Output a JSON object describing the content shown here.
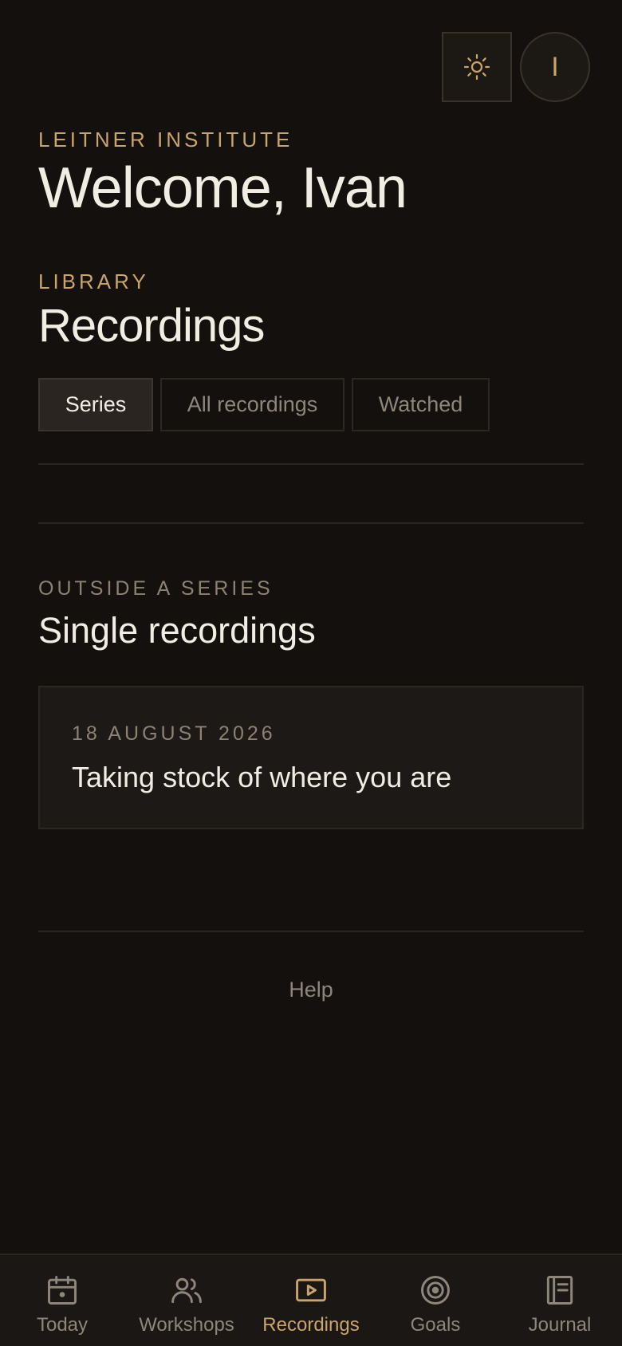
{
  "header": {
    "avatar_initial": "I",
    "theme_icon": "sun-icon"
  },
  "welcome": {
    "org": "LEITNER INSTITUTE",
    "greeting": "Welcome, Ivan"
  },
  "library": {
    "eyebrow": "LIBRARY",
    "title": "Recordings",
    "tabs": [
      {
        "label": "Series",
        "active": true
      },
      {
        "label": "All recordings",
        "active": false
      },
      {
        "label": "Watched",
        "active": false
      }
    ]
  },
  "singles": {
    "eyebrow": "OUTSIDE A SERIES",
    "title": "Single recordings",
    "items": [
      {
        "date": "18 AUGUST 2026",
        "title": "Taking stock of where you are"
      }
    ]
  },
  "footer": {
    "help": "Help"
  },
  "bottom_nav": [
    {
      "label": "Today",
      "icon": "calendar-icon",
      "active": false
    },
    {
      "label": "Workshops",
      "icon": "people-icon",
      "active": false
    },
    {
      "label": "Recordings",
      "icon": "play-icon",
      "active": true
    },
    {
      "label": "Goals",
      "icon": "target-icon",
      "active": false
    },
    {
      "label": "Journal",
      "icon": "journal-icon",
      "active": false
    }
  ],
  "colors": {
    "background": "#13100e",
    "accent": "#c9a56c",
    "text": "#f2ede3",
    "muted": "#8e867a"
  }
}
